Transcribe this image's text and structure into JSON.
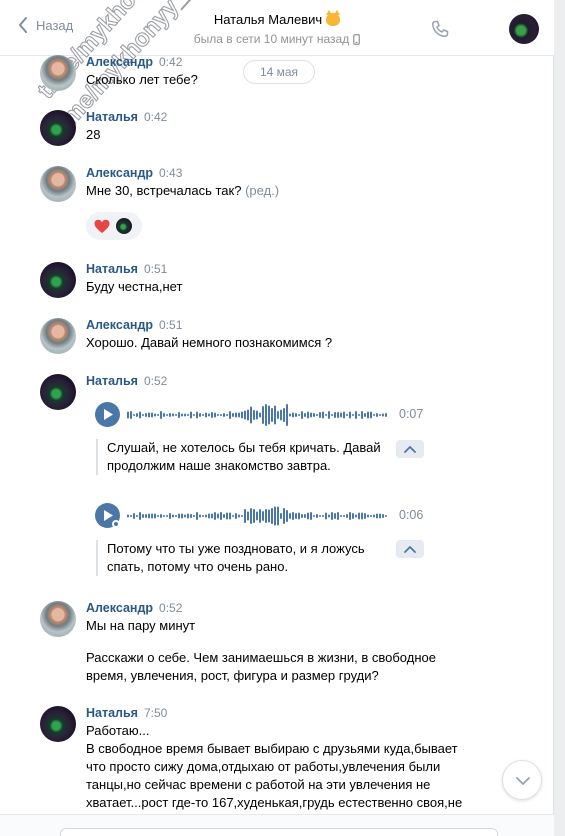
{
  "header": {
    "back_label": "Назад",
    "title": "Наталья Малевич",
    "status": "была в сети 10 минут назад"
  },
  "watermark": {
    "line1": "t.me/mykhonyy_Istraders",
    "line2": "t.me/mykhonyy_Istraders"
  },
  "date_divider": "14 мая",
  "messages": [
    {
      "author": "Александр",
      "time": "0:42",
      "lines": [
        "Сколько лет тебе?"
      ]
    },
    {
      "author": "Наталья",
      "time": "0:42",
      "lines": [
        "28"
      ]
    },
    {
      "author": "Александр",
      "time": "0:43",
      "lines": [
        "Мне 30, встречалась так?"
      ],
      "edited": "(ред.)"
    },
    {
      "author": "Наталья",
      "time": "0:51",
      "lines": [
        "Буду честна,нет"
      ]
    },
    {
      "author": "Александр",
      "time": "0:51",
      "lines": [
        "Хорошо. Давай немного познакомимся ?"
      ]
    },
    {
      "author": "Наталья",
      "time": "0:52"
    },
    {
      "author": "Александр",
      "time": "0:52",
      "lines": [
        "Мы на пару минут",
        "Расскажи о себе. Чем занимаешься в жизни, в свободное",
        "время, увлечения, рост, фигура и размер груди?"
      ]
    },
    {
      "author": "Наталья",
      "time": "7:50",
      "lines": [
        "Работаю...",
        "В свободное время бывает выбираю с друзьями куда,бывает",
        "что просто сижу дома,отдыхаю от работы,увлечения были",
        "танцы,но сейчас времени с работой на эти увлечения не",
        "хватает...рост где-то 167,худенькая,грудь естественно своя,не"
      ]
    }
  ],
  "voice_messages": [
    {
      "duration": "0:07",
      "transcript": [
        "Слушай, не хотелось бы тебя кричать. Давай",
        "продолжим наше знакомство завтра."
      ]
    },
    {
      "duration": "0:06",
      "transcript": [
        "Потому что ты уже поздновато, и я ложусь",
        "спать, потому что очень рано."
      ]
    }
  ],
  "colors": {
    "accent": "#4a76a8",
    "author": "#2a5885",
    "muted": "#818c99",
    "heart": "#e64646"
  }
}
